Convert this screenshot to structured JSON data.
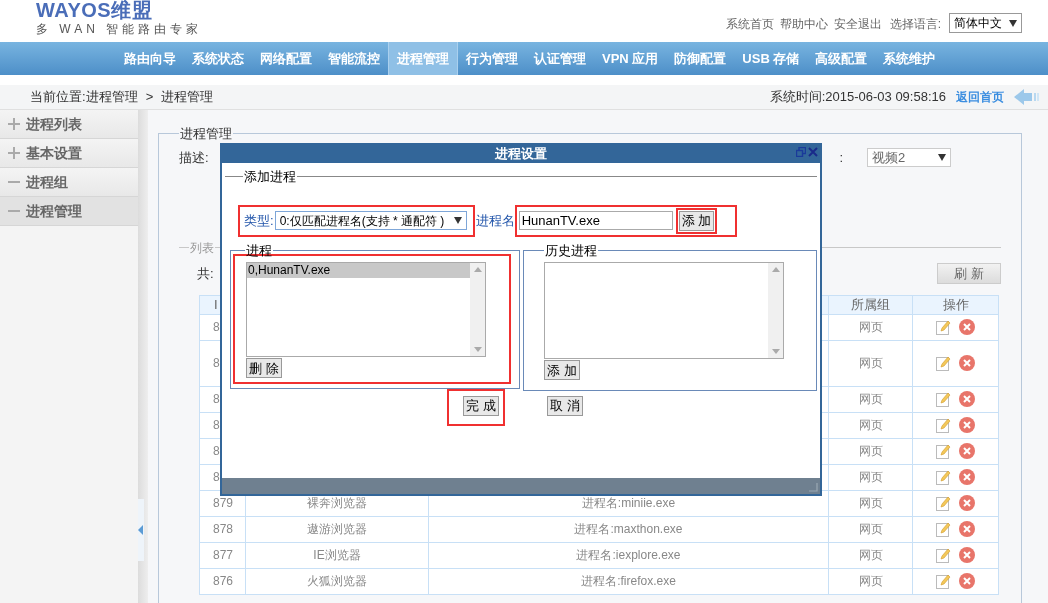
{
  "header": {
    "logo": "WAYOS维盟",
    "tagline": "多 WAN 智能路由专家",
    "links": [
      "系统首页",
      "帮助中心",
      "安全退出"
    ],
    "language_label": "选择语言:",
    "language": "简体中文"
  },
  "nav": [
    {
      "label": "路由向导",
      "selected": false
    },
    {
      "label": "系统状态",
      "selected": false
    },
    {
      "label": "网络配置",
      "selected": false
    },
    {
      "label": "智能流控",
      "selected": false
    },
    {
      "label": "进程管理",
      "selected": true
    },
    {
      "label": "行为管理",
      "selected": false
    },
    {
      "label": "认证管理",
      "selected": false
    },
    {
      "label": "VPN 应用",
      "selected": false
    },
    {
      "label": "防御配置",
      "selected": false
    },
    {
      "label": "USB 存储",
      "selected": false
    },
    {
      "label": "高级配置",
      "selected": false
    },
    {
      "label": "系统维护",
      "selected": false
    }
  ],
  "breadcrumb": {
    "location": "当前位置:进程管理",
    "separator": ">",
    "page": "进程管理",
    "time": "系统时间:2015-06-03 09:58:16",
    "home": "返回首页"
  },
  "sidebar": [
    {
      "label": "进程列表",
      "expanded": false,
      "selected": false
    },
    {
      "label": "基本设置",
      "expanded": false,
      "selected": false
    },
    {
      "label": "进程组",
      "expanded": true,
      "selected": false
    },
    {
      "label": "进程管理",
      "expanded": true,
      "selected": true
    }
  ],
  "panel": {
    "legend": "进程管理",
    "desc_label": "描述:",
    "group_label": ":",
    "group_value": "视频2",
    "list_legend": "列表",
    "total_label": "共:",
    "refresh": "刷 新"
  },
  "table": {
    "columns": {
      "id": "I",
      "group": "所属组",
      "actions": "操作"
    },
    "rows": [
      {
        "id": "8",
        "group": "网页"
      },
      {
        "id": "8",
        "group": "网页"
      },
      {
        "id": "8",
        "group": "网页"
      },
      {
        "id": "8",
        "group": "网页"
      },
      {
        "id": "8",
        "group": "网页"
      },
      {
        "id": "8",
        "group": "网页"
      },
      {
        "id": "879",
        "name": "裸奔浏览器",
        "desc": "进程名:miniie.exe",
        "group": "网页"
      },
      {
        "id": "878",
        "name": "遨游浏览器",
        "desc": "进程名:maxthon.exe",
        "group": "网页"
      },
      {
        "id": "877",
        "name": "IE浏览器",
        "desc": "进程名:iexplore.exe",
        "group": "网页"
      },
      {
        "id": "876",
        "name": "火狐浏览器",
        "desc": "进程名:firefox.exe",
        "group": "网页"
      }
    ]
  },
  "dialog": {
    "title": "进程设置",
    "add_legend": "添加进程",
    "type_label": "类型:",
    "type_value": "0:仅匹配进程名(支持 * 通配符 )",
    "name_label": "进程名",
    "name_value": "HunanTV.exe",
    "add_button": "添 加",
    "process_legend": "进程",
    "processes": [
      {
        "label": "0,HunanTV.exe",
        "selected": true
      }
    ],
    "delete_button": "删 除",
    "history_legend": "历史进程",
    "history_add_button": "添 加",
    "done_button": "完 成",
    "cancel_button": "取 消",
    "highlights": {
      "type": true,
      "name": true,
      "add": true,
      "process": true,
      "done": true
    }
  }
}
